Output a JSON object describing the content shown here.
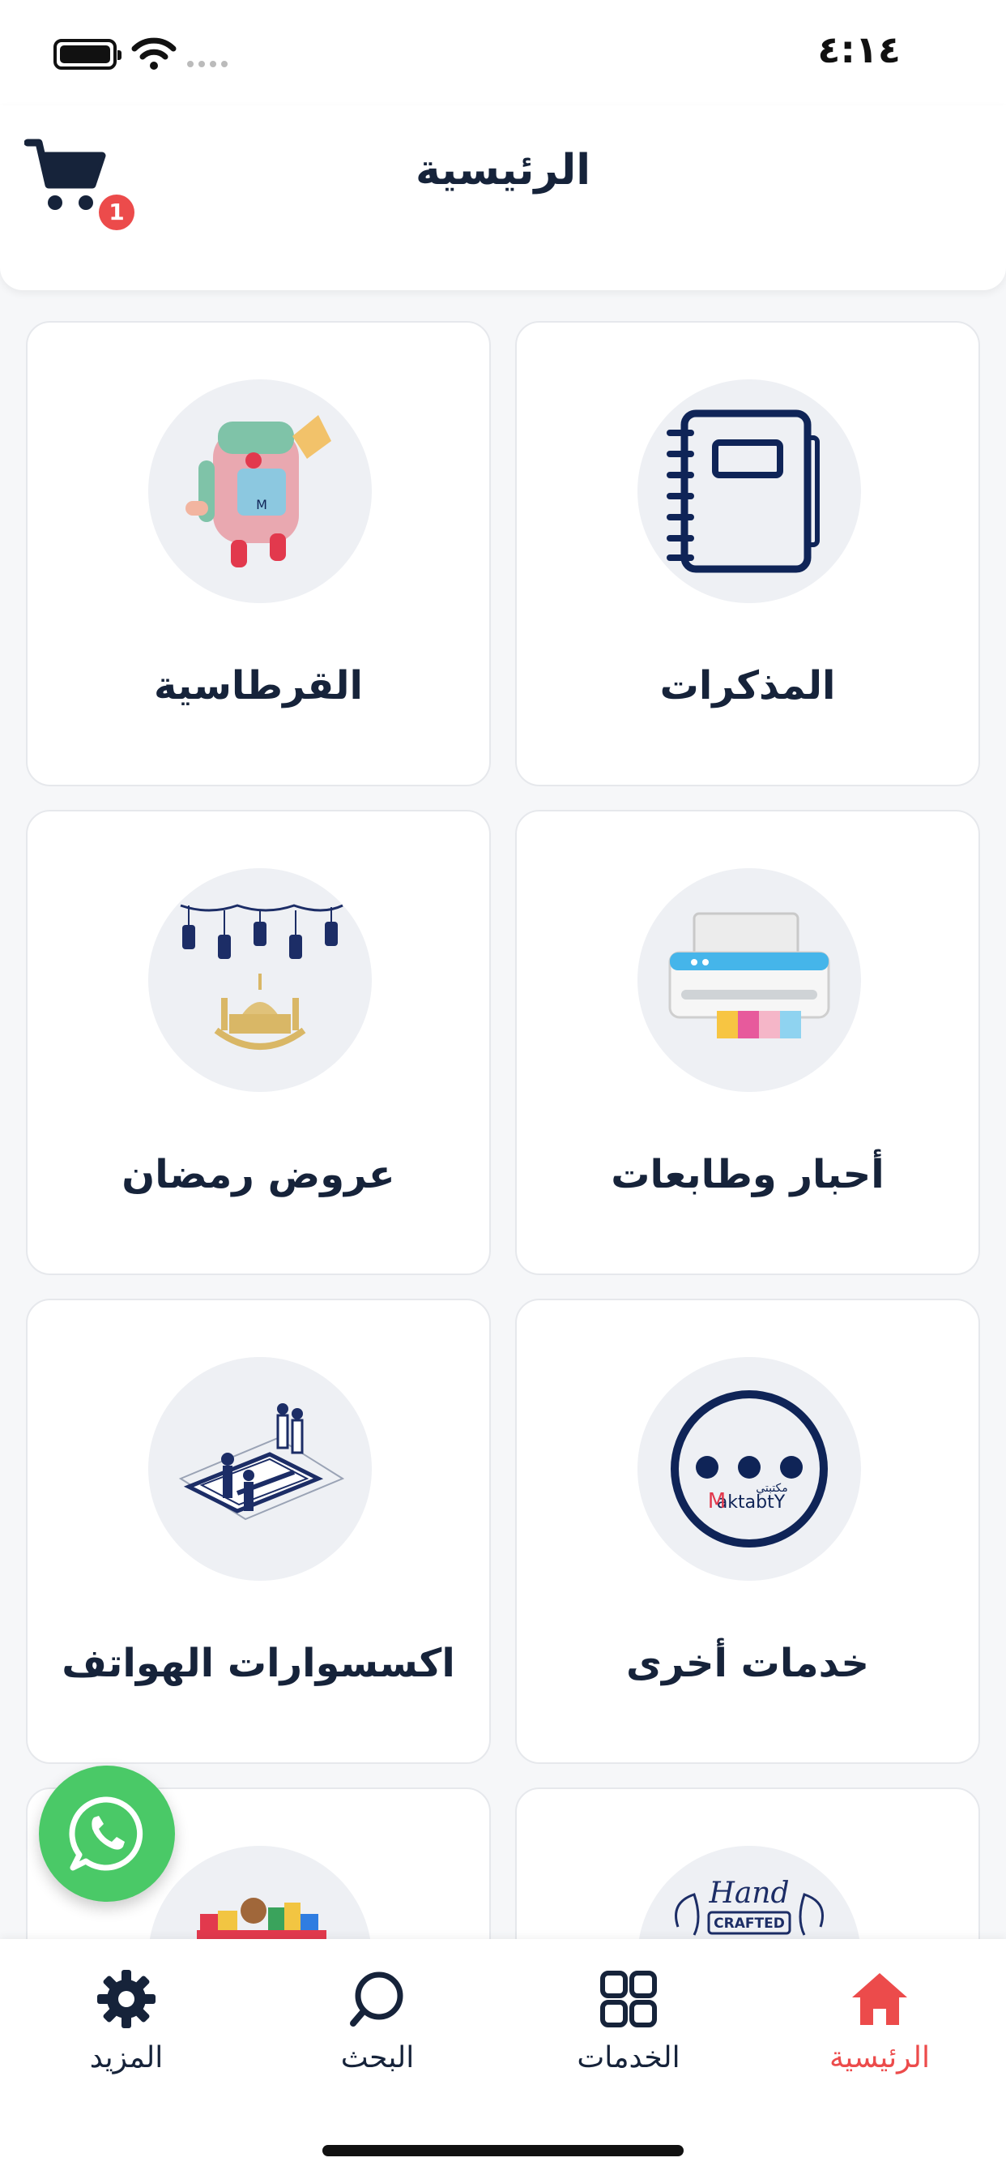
{
  "status_bar": {
    "time": "٤:١٤"
  },
  "header": {
    "title": "الرئيسية",
    "cart_badge": "1"
  },
  "categories": [
    {
      "label": "المذكرات",
      "icon": "notebook-icon"
    },
    {
      "label": "القرطاسية",
      "icon": "school-backpack-icon"
    },
    {
      "label": "أحبار وطابعات",
      "icon": "printer-icon"
    },
    {
      "label": "عروض رمضان",
      "icon": "ramadan-lanterns-icon"
    },
    {
      "label": "خدمات أخرى",
      "icon": "more-dots-icon"
    },
    {
      "label": "اكسسوارات الهواتف",
      "icon": "phone-accessories-icon"
    },
    {
      "label": "",
      "icon": "handcrafted-icon"
    },
    {
      "label": "",
      "icon": "toys-icon"
    }
  ],
  "logo_text": {
    "brand_arabic": "مكتبتي",
    "brand_latin": "aktabtY",
    "brand_initial": "M"
  },
  "handcrafted_text": {
    "line1": "Hand",
    "line2": "CRAFTED"
  },
  "tabbar": {
    "home": "الرئيسية",
    "services": "الخدمات",
    "search": "البحث",
    "more": "المزيد"
  },
  "colors": {
    "accent": "#ec4b4b",
    "navy": "#16233a",
    "whatsapp": "#4ac967"
  }
}
